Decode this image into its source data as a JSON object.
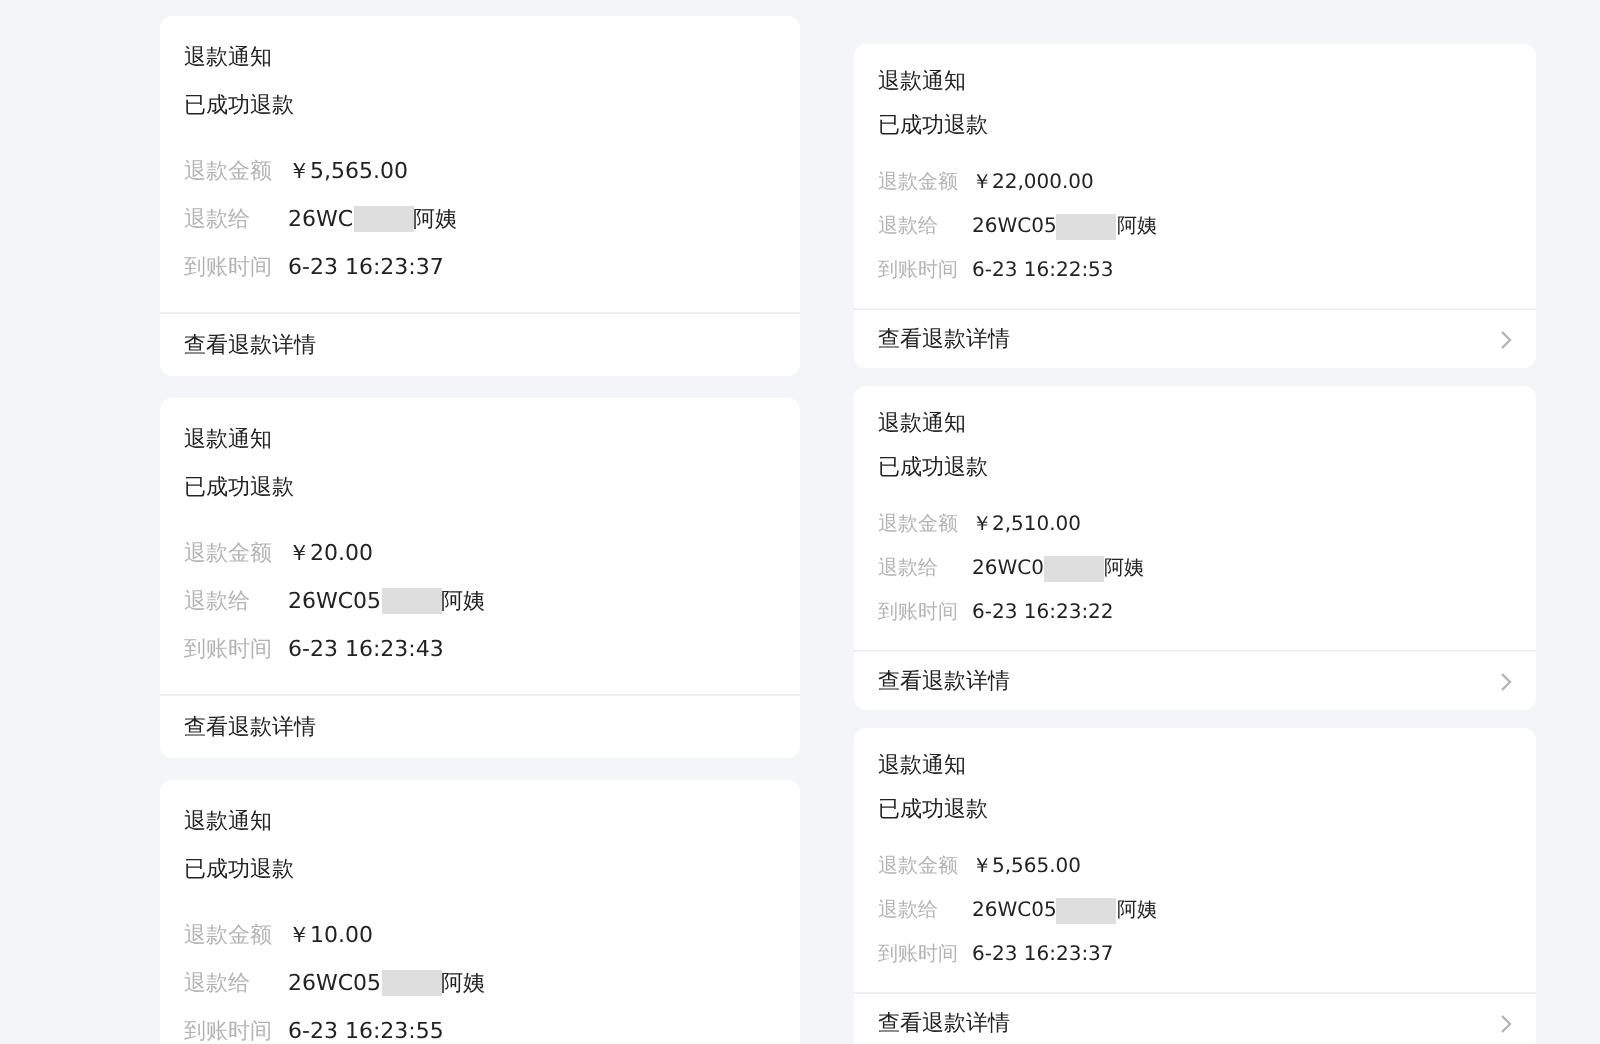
{
  "columns": [
    {
      "cards": [
        {
          "title": "退款通知",
          "status": "已成功退款",
          "fields": [
            {
              "kind": "text",
              "label": "退款金额",
              "value": "￥5,565.00"
            },
            {
              "kind": "masked",
              "label": "退款给",
              "prefix": "26WC",
              "suffix": "阿姨"
            },
            {
              "kind": "text",
              "label": "到账时间",
              "value": "6-23 16:23:37"
            }
          ],
          "link": "查看退款详情",
          "arrow": false
        },
        {
          "title": "退款通知",
          "status": "已成功退款",
          "fields": [
            {
              "kind": "text",
              "label": "退款金额",
              "value": "￥20.00"
            },
            {
              "kind": "masked",
              "label": "退款给",
              "prefix": "26WC05",
              "suffix": "阿姨"
            },
            {
              "kind": "text",
              "label": "到账时间",
              "value": "6-23 16:23:43"
            }
          ],
          "link": "查看退款详情",
          "arrow": false
        },
        {
          "title": "退款通知",
          "status": "已成功退款",
          "fields": [
            {
              "kind": "text",
              "label": "退款金额",
              "value": "￥10.00"
            },
            {
              "kind": "masked",
              "label": "退款给",
              "prefix": "26WC05",
              "suffix": "阿姨"
            },
            {
              "kind": "text",
              "label": "到账时间",
              "value": "6-23 16:23:55"
            }
          ]
        }
      ]
    },
    {
      "cards": [
        {
          "title": "退款通知",
          "status": "已成功退款",
          "fields": [
            {
              "kind": "text",
              "label": "退款金额",
              "value": "￥22,000.00"
            },
            {
              "kind": "masked",
              "label": "退款给",
              "prefix": "26WC05",
              "suffix": "阿姨"
            },
            {
              "kind": "text",
              "label": "到账时间",
              "value": "6-23 16:22:53"
            }
          ],
          "link": "查看退款详情",
          "arrow": true
        },
        {
          "title": "退款通知",
          "status": "已成功退款",
          "fields": [
            {
              "kind": "text",
              "label": "退款金额",
              "value": "￥2,510.00"
            },
            {
              "kind": "masked",
              "label": "退款给",
              "prefix": "26WC0",
              "suffix": "阿姨"
            },
            {
              "kind": "text",
              "label": "到账时间",
              "value": "6-23 16:23:22"
            }
          ],
          "link": "查看退款详情",
          "arrow": true
        },
        {
          "title": "退款通知",
          "status": "已成功退款",
          "fields": [
            {
              "kind": "text",
              "label": "退款金额",
              "value": "￥5,565.00"
            },
            {
              "kind": "masked",
              "label": "退款给",
              "prefix": "26WC05",
              "suffix": "阿姨"
            },
            {
              "kind": "text",
              "label": "到账时间",
              "value": "6-23 16:23:37"
            }
          ],
          "link": "查看退款详情",
          "arrow": true
        }
      ]
    }
  ]
}
